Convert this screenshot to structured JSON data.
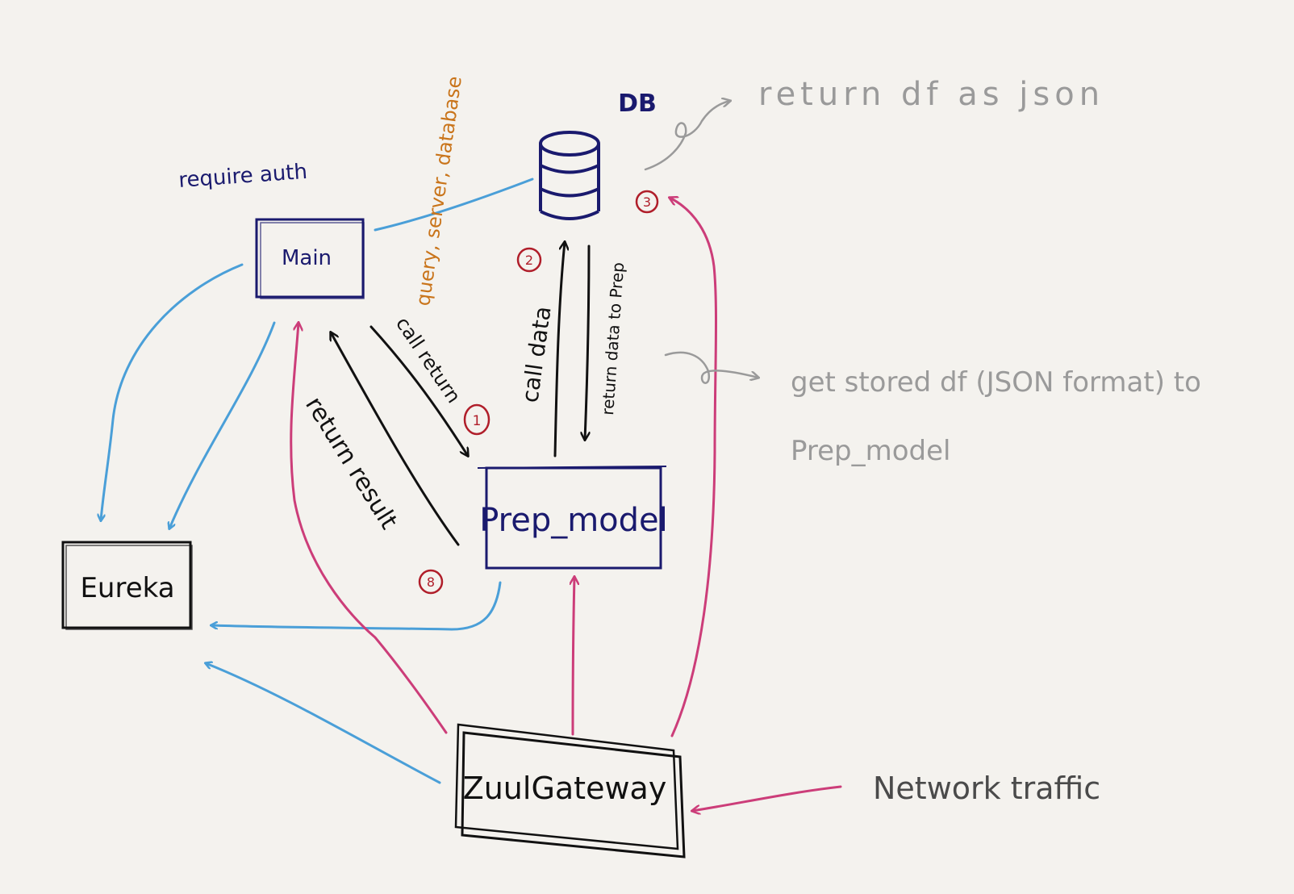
{
  "colors": {
    "paper": "#f4f2ee",
    "navy": "#1a1a6e",
    "black": "#111111",
    "blue": "#4a9fd8",
    "pink": "#cc3d79",
    "red": "#b01e2a",
    "orange": "#c9741a",
    "gray": "#9a9a9a",
    "darkgray": "#4a4a4a"
  },
  "nodes": {
    "main": "Main",
    "prep_model": "Prep_model",
    "eureka": "Eureka",
    "zuul": "ZuulGateway",
    "db": "DB"
  },
  "labels": {
    "require_auth": "require auth",
    "query_server_database": "query, server, database",
    "call_return": "call return",
    "return_result": "return result",
    "call_data": "call data",
    "return_data": "return data to Prep",
    "network_traffic": "Network traffic"
  },
  "steps": {
    "step1": "1",
    "step2": "2",
    "step3": "3",
    "step8": "8"
  },
  "notes": {
    "db_note": "return df as json",
    "prep_note_line1": "get stored df (JSON format) to",
    "prep_note_line2": "Prep_model"
  }
}
